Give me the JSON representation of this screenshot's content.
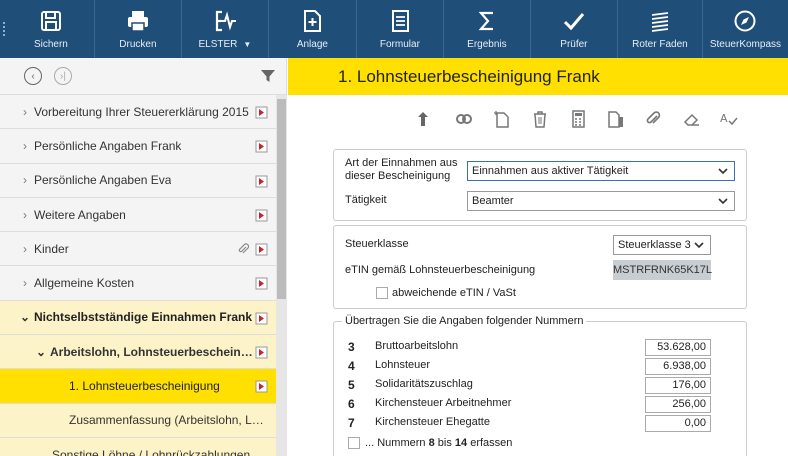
{
  "toolbar": {
    "buttons": [
      {
        "label": "Sichern",
        "icon": "save-icon"
      },
      {
        "label": "Drucken",
        "icon": "print-icon"
      },
      {
        "label": "ELSTER",
        "icon": "elster-icon"
      },
      {
        "label": "Anlage",
        "icon": "add-document-icon"
      },
      {
        "label": "Formular",
        "icon": "form-icon"
      },
      {
        "label": "Ergebnis",
        "icon": "sum-icon"
      },
      {
        "label": "Prüfer",
        "icon": "check-icon"
      },
      {
        "label": "Roter Faden",
        "icon": "thread-icon"
      },
      {
        "label": "SteuerKompass",
        "icon": "compass-icon"
      }
    ]
  },
  "sidebar": {
    "items": [
      {
        "label": "Vorbereitung Ihrer Steuererklärung 2015"
      },
      {
        "label": "Persönliche Angaben Frank"
      },
      {
        "label": "Persönliche Angaben Eva"
      },
      {
        "label": "Weitere Angaben"
      },
      {
        "label": "Kinder"
      },
      {
        "label": "Allgemeine Kosten"
      },
      {
        "label": "Nichtselbstständige Einnahmen Frank"
      },
      {
        "label": "Arbeitslohn, Lohnsteuerbescheinigung"
      },
      {
        "label": "1. Lohnsteuerbescheinigung"
      },
      {
        "label": "Zusammenfassung (Arbeitslohn, Lohnsteuerbescheinigung)"
      },
      {
        "label": "Sonstige Löhne / Lohnrückzahlungen / Steuer..."
      }
    ]
  },
  "main": {
    "title": "1. Lohnsteuerbescheinigung Frank",
    "art_label": "Art der Einnahmen aus dieser Bescheinigung",
    "art_value": "Einnahmen aus aktiver Tätigkeit",
    "taetigkeit_label": "Tätigkeit",
    "taetigkeit_value": "Beamter",
    "steuerklasse_label": "Steuerklasse",
    "steuerklasse_value": "Steuerklasse 3",
    "etin_label": "eTIN gemäß Lohnsteuerbescheinigung",
    "etin_value": "MSTRFRNK65K17L",
    "abweichende_label": "abweichende eTIN / VaSt",
    "uebertragen_label": "Übertragen Sie die Angaben folgender Nummern",
    "rows": [
      {
        "num": "3",
        "label": "Bruttoarbeitslohn",
        "value": "53.628,00"
      },
      {
        "num": "4",
        "label": "Lohnsteuer",
        "value": "6.938,00"
      },
      {
        "num": "5",
        "label": "Solidaritätszuschlag",
        "value": "176,00"
      },
      {
        "num": "6",
        "label": "Kirchensteuer Arbeitnehmer",
        "value": "256,00"
      },
      {
        "num": "7",
        "label": "Kirchensteuer Ehegatte",
        "value": "0,00"
      }
    ],
    "nummern_prefix": "... Nummern",
    "nummern_8": "8",
    "nummern_bis": "bis",
    "nummern_14": "14",
    "nummern_suffix": "erfassen"
  }
}
